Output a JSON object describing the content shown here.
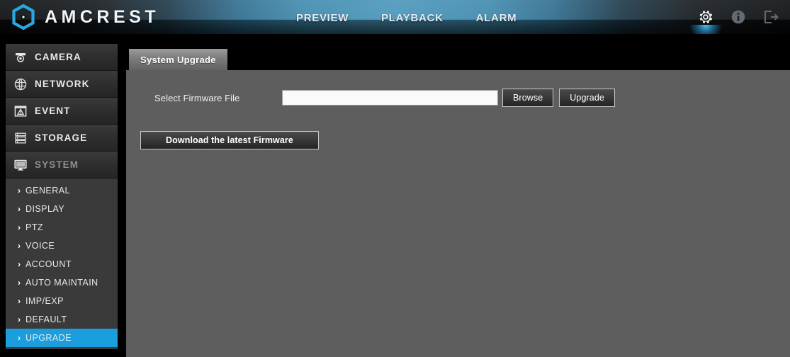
{
  "header": {
    "brand": "AMCREST",
    "logo_icon": "amcrest-hexagon-logo-icon",
    "logo_color": "#29a8e0",
    "nav": [
      {
        "label": "PREVIEW",
        "name": "nav-preview"
      },
      {
        "label": "PLAYBACK",
        "name": "nav-playback"
      },
      {
        "label": "ALARM",
        "name": "nav-alarm"
      }
    ],
    "icons": [
      {
        "name": "gear-icon",
        "label": "Settings",
        "active": true
      },
      {
        "name": "info-icon",
        "label": "Info",
        "active": false
      },
      {
        "name": "logout-icon",
        "label": "Logout",
        "active": false
      }
    ],
    "accent_color": "#4a96bb"
  },
  "sidebar": {
    "items": [
      {
        "label": "CAMERA",
        "icon": "camera-dome-icon",
        "expanded": false
      },
      {
        "label": "NETWORK",
        "icon": "network-globe-icon",
        "expanded": false
      },
      {
        "label": "EVENT",
        "icon": "event-alert-icon",
        "expanded": false
      },
      {
        "label": "STORAGE",
        "icon": "storage-stack-icon",
        "expanded": false
      },
      {
        "label": "SYSTEM",
        "icon": "system-monitor-icon",
        "expanded": true
      }
    ],
    "submenu": [
      {
        "label": "GENERAL",
        "active": false
      },
      {
        "label": "DISPLAY",
        "active": false
      },
      {
        "label": "PTZ",
        "active": false
      },
      {
        "label": "VOICE",
        "active": false
      },
      {
        "label": "ACCOUNT",
        "active": false
      },
      {
        "label": "AUTO MAINTAIN",
        "active": false
      },
      {
        "label": "IMP/EXP",
        "active": false
      },
      {
        "label": "DEFAULT",
        "active": false
      },
      {
        "label": "UPGRADE",
        "active": true
      }
    ],
    "chevron": "›",
    "active_color": "#1a9ede"
  },
  "main": {
    "tab": {
      "label": "System Upgrade"
    },
    "firmware": {
      "label": "Select Firmware File",
      "input_value": "",
      "input_placeholder": "",
      "browse_label": "Browse",
      "upgrade_label": "Upgrade"
    },
    "download_label": "Download the latest Firmware"
  }
}
